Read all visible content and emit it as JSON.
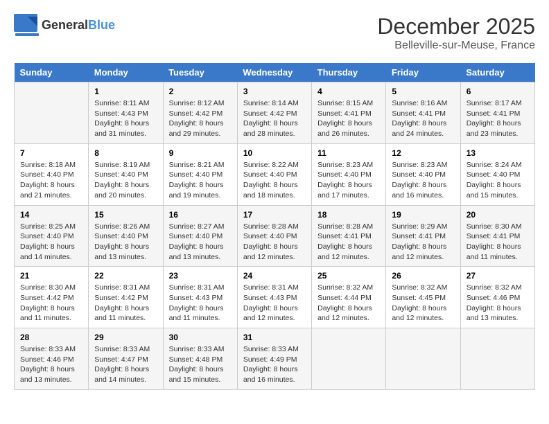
{
  "header": {
    "logo_general": "General",
    "logo_blue": "Blue",
    "month": "December 2025",
    "location": "Belleville-sur-Meuse, France"
  },
  "weekdays": [
    "Sunday",
    "Monday",
    "Tuesday",
    "Wednesday",
    "Thursday",
    "Friday",
    "Saturday"
  ],
  "weeks": [
    [
      {
        "day": "",
        "info": ""
      },
      {
        "day": "1",
        "info": "Sunrise: 8:11 AM\nSunset: 4:43 PM\nDaylight: 8 hours\nand 31 minutes."
      },
      {
        "day": "2",
        "info": "Sunrise: 8:12 AM\nSunset: 4:42 PM\nDaylight: 8 hours\nand 29 minutes."
      },
      {
        "day": "3",
        "info": "Sunrise: 8:14 AM\nSunset: 4:42 PM\nDaylight: 8 hours\nand 28 minutes."
      },
      {
        "day": "4",
        "info": "Sunrise: 8:15 AM\nSunset: 4:41 PM\nDaylight: 8 hours\nand 26 minutes."
      },
      {
        "day": "5",
        "info": "Sunrise: 8:16 AM\nSunset: 4:41 PM\nDaylight: 8 hours\nand 24 minutes."
      },
      {
        "day": "6",
        "info": "Sunrise: 8:17 AM\nSunset: 4:41 PM\nDaylight: 8 hours\nand 23 minutes."
      }
    ],
    [
      {
        "day": "7",
        "info": "Sunrise: 8:18 AM\nSunset: 4:40 PM\nDaylight: 8 hours\nand 21 minutes."
      },
      {
        "day": "8",
        "info": "Sunrise: 8:19 AM\nSunset: 4:40 PM\nDaylight: 8 hours\nand 20 minutes."
      },
      {
        "day": "9",
        "info": "Sunrise: 8:21 AM\nSunset: 4:40 PM\nDaylight: 8 hours\nand 19 minutes."
      },
      {
        "day": "10",
        "info": "Sunrise: 8:22 AM\nSunset: 4:40 PM\nDaylight: 8 hours\nand 18 minutes."
      },
      {
        "day": "11",
        "info": "Sunrise: 8:23 AM\nSunset: 4:40 PM\nDaylight: 8 hours\nand 17 minutes."
      },
      {
        "day": "12",
        "info": "Sunrise: 8:23 AM\nSunset: 4:40 PM\nDaylight: 8 hours\nand 16 minutes."
      },
      {
        "day": "13",
        "info": "Sunrise: 8:24 AM\nSunset: 4:40 PM\nDaylight: 8 hours\nand 15 minutes."
      }
    ],
    [
      {
        "day": "14",
        "info": "Sunrise: 8:25 AM\nSunset: 4:40 PM\nDaylight: 8 hours\nand 14 minutes."
      },
      {
        "day": "15",
        "info": "Sunrise: 8:26 AM\nSunset: 4:40 PM\nDaylight: 8 hours\nand 13 minutes."
      },
      {
        "day": "16",
        "info": "Sunrise: 8:27 AM\nSunset: 4:40 PM\nDaylight: 8 hours\nand 13 minutes."
      },
      {
        "day": "17",
        "info": "Sunrise: 8:28 AM\nSunset: 4:40 PM\nDaylight: 8 hours\nand 12 minutes."
      },
      {
        "day": "18",
        "info": "Sunrise: 8:28 AM\nSunset: 4:41 PM\nDaylight: 8 hours\nand 12 minutes."
      },
      {
        "day": "19",
        "info": "Sunrise: 8:29 AM\nSunset: 4:41 PM\nDaylight: 8 hours\nand 12 minutes."
      },
      {
        "day": "20",
        "info": "Sunrise: 8:30 AM\nSunset: 4:41 PM\nDaylight: 8 hours\nand 11 minutes."
      }
    ],
    [
      {
        "day": "21",
        "info": "Sunrise: 8:30 AM\nSunset: 4:42 PM\nDaylight: 8 hours\nand 11 minutes."
      },
      {
        "day": "22",
        "info": "Sunrise: 8:31 AM\nSunset: 4:42 PM\nDaylight: 8 hours\nand 11 minutes."
      },
      {
        "day": "23",
        "info": "Sunrise: 8:31 AM\nSunset: 4:43 PM\nDaylight: 8 hours\nand 11 minutes."
      },
      {
        "day": "24",
        "info": "Sunrise: 8:31 AM\nSunset: 4:43 PM\nDaylight: 8 hours\nand 12 minutes."
      },
      {
        "day": "25",
        "info": "Sunrise: 8:32 AM\nSunset: 4:44 PM\nDaylight: 8 hours\nand 12 minutes."
      },
      {
        "day": "26",
        "info": "Sunrise: 8:32 AM\nSunset: 4:45 PM\nDaylight: 8 hours\nand 12 minutes."
      },
      {
        "day": "27",
        "info": "Sunrise: 8:32 AM\nSunset: 4:46 PM\nDaylight: 8 hours\nand 13 minutes."
      }
    ],
    [
      {
        "day": "28",
        "info": "Sunrise: 8:33 AM\nSunset: 4:46 PM\nDaylight: 8 hours\nand 13 minutes."
      },
      {
        "day": "29",
        "info": "Sunrise: 8:33 AM\nSunset: 4:47 PM\nDaylight: 8 hours\nand 14 minutes."
      },
      {
        "day": "30",
        "info": "Sunrise: 8:33 AM\nSunset: 4:48 PM\nDaylight: 8 hours\nand 15 minutes."
      },
      {
        "day": "31",
        "info": "Sunrise: 8:33 AM\nSunset: 4:49 PM\nDaylight: 8 hours\nand 16 minutes."
      },
      {
        "day": "",
        "info": ""
      },
      {
        "day": "",
        "info": ""
      },
      {
        "day": "",
        "info": ""
      }
    ]
  ]
}
